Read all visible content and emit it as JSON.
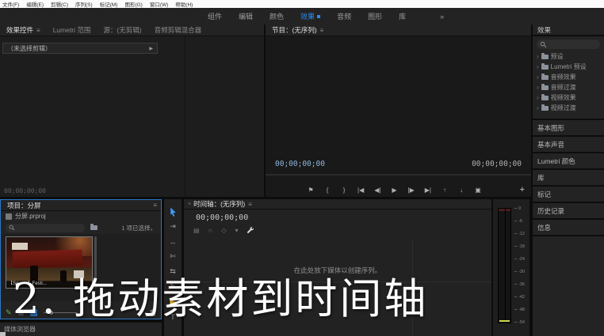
{
  "colors": {
    "accent": "#2d8ceb",
    "timecode_blue": "#8fb6dd",
    "meter_peak": "#cdd74a",
    "tool_active": "#3f9bfa",
    "writable_green": "#6fae4e",
    "panel_bg": "#232323"
  },
  "menu_bar": {
    "items": [
      "文件(F)",
      "编辑(E)",
      "剪辑(C)",
      "序列(S)",
      "标记(M)",
      "图形(G)",
      "窗口(W)",
      "帮助(H)"
    ]
  },
  "workspace": {
    "tabs": [
      "组件",
      "编辑",
      "颜色",
      "效果",
      "音频",
      "图形",
      "库"
    ],
    "active": "效果",
    "overflow": "»"
  },
  "effect_controls": {
    "tabs": [
      "效果控件",
      "Lumetri 范围",
      "源：(无剪辑)",
      "音频剪辑混合器"
    ],
    "active_tab": "效果控件",
    "menu_icon": "≡",
    "empty_clip": "（未选择剪辑）",
    "expander": "▶",
    "timecode": "00;00;00;00"
  },
  "program_monitor": {
    "tab": "节目：(无序列)",
    "menu_icon": "≡",
    "timecode_current": "00;00;00;00",
    "timecode_duration": "00;00;00;00",
    "transport": [
      {
        "name": "add-marker",
        "glyph": "⚑"
      },
      {
        "name": "mark-in",
        "glyph": "{"
      },
      {
        "name": "mark-out",
        "glyph": "}"
      },
      {
        "name": "go-to-in",
        "glyph": "|◀"
      },
      {
        "name": "step-back",
        "glyph": "◀|"
      },
      {
        "name": "play",
        "glyph": "▶"
      },
      {
        "name": "step-forward",
        "glyph": "|▶"
      },
      {
        "name": "go-to-out",
        "glyph": "▶|"
      },
      {
        "name": "lift",
        "glyph": "↑"
      },
      {
        "name": "extract",
        "glyph": "↓"
      },
      {
        "name": "export-frame",
        "glyph": "▣"
      }
    ],
    "button_editor": "+"
  },
  "effects_panel": {
    "title": "效果",
    "chevron": "›",
    "tree": [
      {
        "label": "预设"
      },
      {
        "label": "Lumetri 预设"
      },
      {
        "label": "音频效果"
      },
      {
        "label": "音频过渡"
      },
      {
        "label": "视频效果"
      },
      {
        "label": "视频过渡"
      }
    ],
    "stacked_panels": [
      "基本图形",
      "基本声音",
      "Lumetri 颜色",
      "库",
      "标记",
      "历史记录",
      "信息"
    ]
  },
  "project_panel": {
    "tab": "项目：分屏",
    "menu_icon": "≡",
    "project_file": "分屏.prproj",
    "selection_status": "1 项已选择，",
    "clip_caption": "【Seve...】Festi...",
    "bottom_panel_tab": "媒体浏览器"
  },
  "tools": {
    "items": [
      {
        "name": "selection-tool",
        "glyph": ""
      },
      {
        "name": "track-select-forward-tool",
        "glyph": "⇥"
      },
      {
        "name": "ripple-edit-tool",
        "glyph": "↔"
      },
      {
        "name": "razor-tool",
        "glyph": "✄"
      },
      {
        "name": "slip-tool",
        "glyph": "⇆"
      },
      {
        "name": "pen-tool",
        "glyph": "✎"
      },
      {
        "name": "hand-tool",
        "glyph": "✋"
      },
      {
        "name": "type-tool",
        "glyph": "T"
      }
    ]
  },
  "timeline": {
    "tab": "时间轴：(无序列)",
    "close_icon": "×",
    "menu_icon": "≡",
    "timecode": "00;00;00;00",
    "toolbar": [
      {
        "name": "insert-overwrite-settings",
        "glyph": "▤"
      },
      {
        "name": "snap",
        "glyph": "∩"
      },
      {
        "name": "linked-selection",
        "glyph": "◇"
      },
      {
        "name": "add-marker",
        "glyph": "▾"
      }
    ],
    "empty_message": "在此处放下媒体以创建序列。"
  },
  "audio_meter": {
    "labels": [
      "0",
      "-6",
      "-12",
      "-18",
      "-24",
      "-30",
      "-36",
      "-42",
      "-48",
      "-54"
    ]
  },
  "overlay": {
    "text": "2. 拖动素材到时间轴"
  }
}
